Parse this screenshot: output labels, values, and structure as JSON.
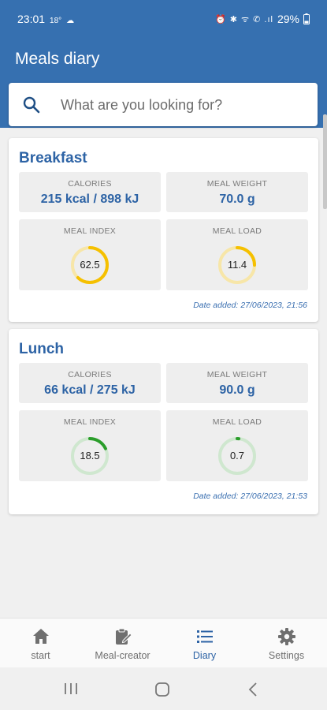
{
  "status": {
    "time": "23:01",
    "temp": "18°",
    "icons": "⏰ ✱ ᯤ ✆ .ıl",
    "battery": "29%"
  },
  "app": {
    "title": "Meals diary"
  },
  "search": {
    "placeholder": "What are you looking for?"
  },
  "meals": [
    {
      "name": "Breakfast",
      "calories_label": "CALORIES",
      "calories": "215 kcal / 898 kJ",
      "weight_label": "MEAL WEIGHT",
      "weight": "70.0 g",
      "index_label": "MEAL INDEX",
      "index": "62.5",
      "index_fraction": 0.62,
      "index_color": "#f5c000",
      "index_track": "#f7e6a8",
      "load_label": "MEAL LOAD",
      "load": "11.4",
      "load_fraction": 0.25,
      "load_color": "#f5c000",
      "load_track": "#f7e6a8",
      "date": "Date added: 27/06/2023, 21:56"
    },
    {
      "name": "Lunch",
      "calories_label": "CALORIES",
      "calories": "66 kcal / 275 kJ",
      "weight_label": "MEAL WEIGHT",
      "weight": "90.0 g",
      "index_label": "MEAL INDEX",
      "index": "18.5",
      "index_fraction": 0.18,
      "index_color": "#2a9d2a",
      "index_track": "#cfe7cf",
      "load_label": "MEAL LOAD",
      "load": "0.7",
      "load_fraction": 0.015,
      "load_color": "#2a9d2a",
      "load_track": "#cfe7cf",
      "date": "Date added: 27/06/2023, 21:53"
    }
  ],
  "nav": [
    {
      "label": "start",
      "icon": "home-icon",
      "active": false
    },
    {
      "label": "Meal-creator",
      "icon": "clipboard-edit-icon",
      "active": false
    },
    {
      "label": "Diary",
      "icon": "list-icon",
      "active": true
    },
    {
      "label": "Settings",
      "icon": "gear-icon",
      "active": false
    }
  ],
  "colors": {
    "primary": "#3670b0",
    "accent": "#2d63a5"
  }
}
